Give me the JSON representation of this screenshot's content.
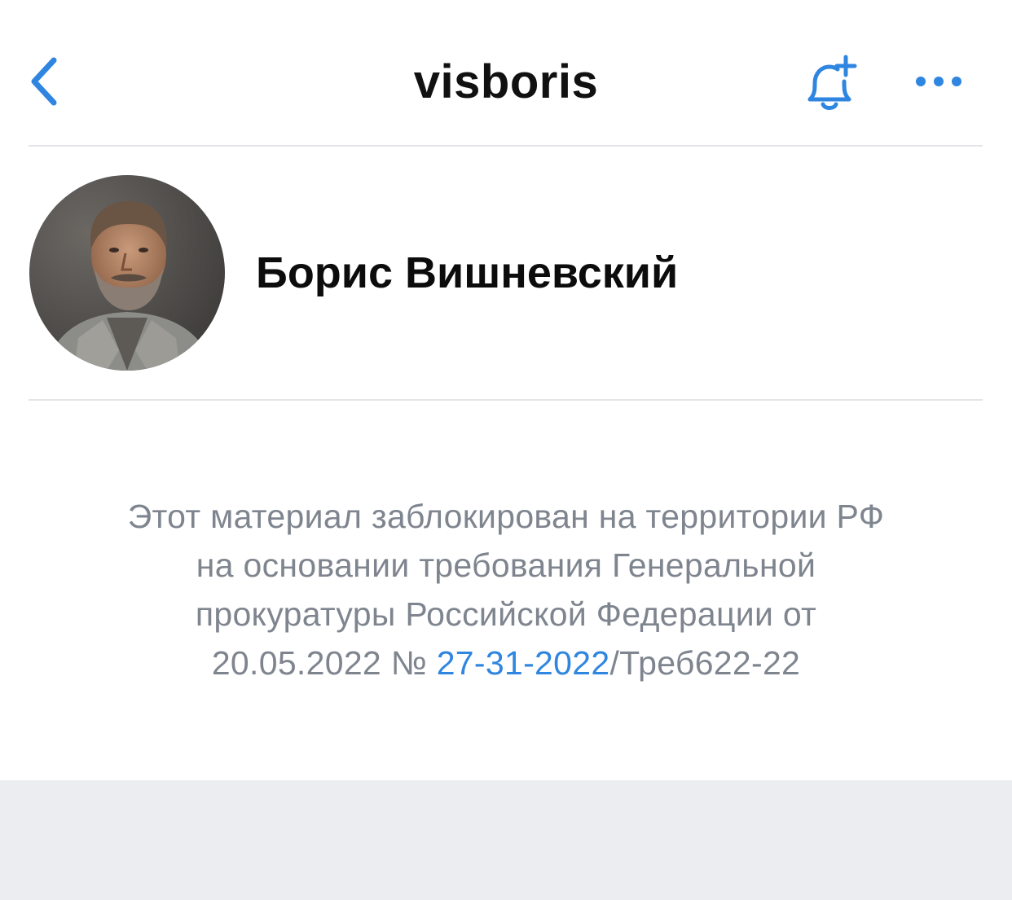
{
  "header": {
    "title": "visboris",
    "back_icon": "chevron-left-icon",
    "subscribe_icon": "bell-plus-icon",
    "more_icon": "more-horizontal-icon",
    "accent_color": "#2f86e0"
  },
  "profile": {
    "name": "Борис Вишневский",
    "avatar_icon": "profile-photo"
  },
  "notice": {
    "line1": "Этот материал заблокирован на территории РФ",
    "line2": "на основании требования Генеральной",
    "line3": "прокуратуры Российской Федерации от",
    "line4_prefix": "20.05.2022 № ",
    "line4_link": "27-31-2022",
    "line4_suffix": "/Треб622-22",
    "text_color": "#7f858f",
    "link_color": "#2f86e0"
  }
}
